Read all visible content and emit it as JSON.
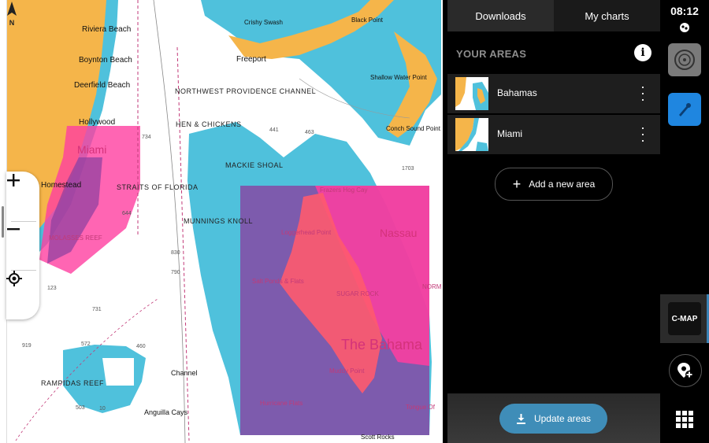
{
  "map": {
    "labels": {
      "riviera_beach": "Riviera Beach",
      "boynton_beach": "Boynton Beach",
      "deerfield_beach": "Deerfield Beach",
      "hollywood": "Hollywood",
      "miami": "Miami",
      "homestead": "Homestead",
      "molasses_reef": "MOLASSES REEF",
      "straits_of_florida": "STRAITS OF FLORIDA",
      "northwest_providence_channel": "NORTHWEST PROVIDENCE CHANNEL",
      "hen_chickens": "HEN & CHICKENS",
      "mackie_shoal": "MACKIE SHOAL",
      "munnings_knoll": "MUNNINGS KNOLL",
      "crishy_swash": "Crishy Swash",
      "freeport": "Freeport",
      "black_point": "Black Point",
      "shallow_water_point": "Shallow Water Point",
      "conch_sound_point": "Conch Sound Point",
      "frazers_hog_cay": "Frazers Hog Cay",
      "nassau": "Nassau",
      "loggerhead_point": "Loggerhead Point",
      "salt_ponds_flats": "Salt Ponds & Flats",
      "sugar_rock": "SUGAR ROCK",
      "norman": "NORM",
      "the_bahamas": "The Bahama",
      "muddy_point": "Muddy Point",
      "hurricane_flats": "Hurricane Flats",
      "tongue_of": "Tongue Of",
      "scott_rocks": "Scott Rocks",
      "rampidas_reef": "RAMPIDAS REEF",
      "channel": "Channel",
      "anguilla_cays": "Anguilla Cays"
    },
    "depths": {
      "d441": "441",
      "d463": "463",
      "d1703": "1703",
      "d734": "734",
      "d644": "644",
      "d830": "830",
      "d790": "790",
      "d123": "123",
      "d731": "731",
      "d919": "919",
      "d572": "572",
      "d460": "460",
      "d503": "503",
      "d10": "10"
    }
  },
  "panel": {
    "tabs": [
      {
        "label": "Downloads",
        "active": true
      },
      {
        "label": "My charts",
        "active": false
      }
    ],
    "section_title": "YOUR AREAS",
    "areas": [
      {
        "name": "Bahamas"
      },
      {
        "name": "Miami"
      }
    ],
    "add_area_label": "Add a new area",
    "update_label": "Update areas"
  },
  "rail": {
    "time": "08:12",
    "cmap_logo": "C-MAP"
  },
  "colors": {
    "land": "#f5b54a",
    "shallow": "#4fc1dc",
    "area_pink": "#ff3ea0",
    "area_purple": "#8a3fa0",
    "accent_blue": "#3f8db8",
    "panel_row": "#1e1e1e"
  },
  "icons": {
    "compass": "compass-icon",
    "zoom_in": "plus-icon",
    "zoom_out": "minus-icon",
    "locate": "crosshair-icon",
    "info": "info-icon",
    "more": "kebab-icon",
    "add": "plus-icon",
    "download": "download-icon",
    "settings_disc": "disc-icon",
    "navigation": "navigation-icon",
    "add_pin": "add-pin-icon",
    "apps": "grid-icon"
  }
}
